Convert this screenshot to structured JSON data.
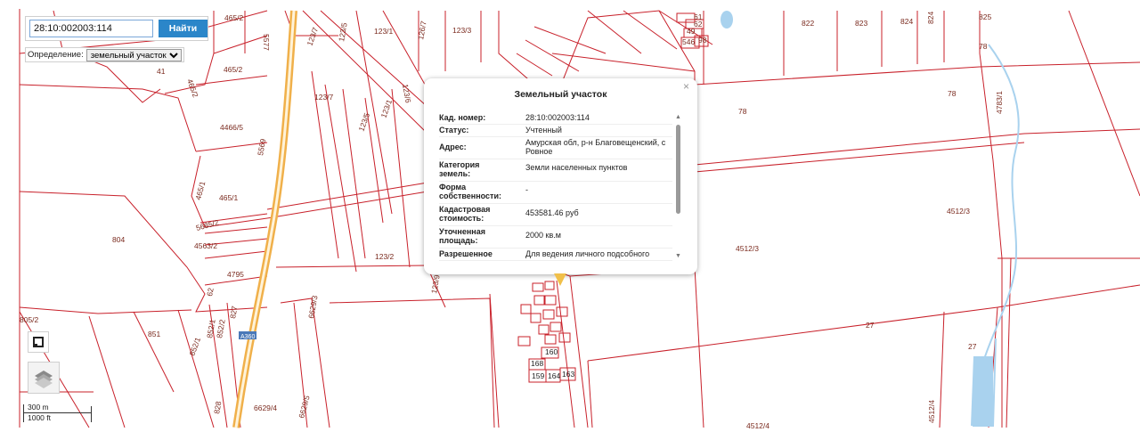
{
  "search": {
    "value": "28:10:002003:114",
    "button_label": "Найти"
  },
  "definition": {
    "label": "Определение:",
    "selected": "земельный участок"
  },
  "popup": {
    "title": "Земельный участок",
    "close_symbol": "×",
    "rows": [
      {
        "key": "Кад. номер:",
        "value": "28:10:002003:114"
      },
      {
        "key": "Статус:",
        "value": "Учтенный"
      },
      {
        "key": "Адрес:",
        "value": "Амурская обл, р-н Благовещенский, с Ровное"
      },
      {
        "key": "Категория земель:",
        "value": "Земли населенных пунктов"
      },
      {
        "key": "Форма собственности:",
        "value": "-"
      },
      {
        "key": "Кадастровая стоимость:",
        "value": "453581.46 руб"
      },
      {
        "key": "Уточненная площадь:",
        "value": "2000 кв.м"
      },
      {
        "key": "Разрешенное",
        "value": "Для ведения личного подсобного"
      }
    ]
  },
  "scale": {
    "top": "300 m",
    "bottom": "1000 ft"
  },
  "parcel_labels": [
    "465/2",
    "5577",
    "123/7",
    "123/5",
    "123/1",
    "126/7",
    "123/3",
    "465/2",
    "41",
    "465/2",
    "123/6",
    "123/7",
    "4466/5",
    "123/5",
    "123/1",
    "5569",
    "465/1",
    "465/1",
    "5685/2",
    "4563/2",
    "804",
    "4795",
    "62",
    "123/2",
    "6629/3",
    "123/9",
    "805/2",
    "851",
    "852/1",
    "852/1",
    "827",
    "852/2",
    "828",
    "6629/4",
    "6629/5",
    "160",
    "168",
    "159",
    "164",
    "163",
    "822",
    "823",
    "824",
    "824",
    "825",
    "78",
    "4783/1",
    "78",
    "78",
    "4512/3",
    "4512/3",
    "27",
    "27",
    "4512/4",
    "4512/4",
    "49",
    "61",
    "62",
    "546",
    "98"
  ],
  "road_shield": "А360",
  "colors": {
    "parcel_line": "#c8202a",
    "road": "#f0b04a",
    "water": "#a9d2ee",
    "button": "#2b86c9"
  }
}
